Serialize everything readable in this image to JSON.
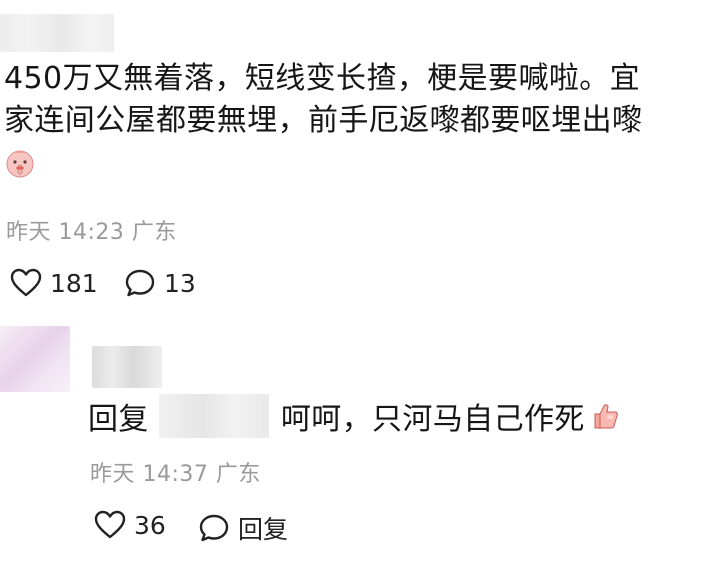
{
  "comment": {
    "text_line1": "450万又無着落，短线变长揸，梗是要喊啦。宜",
    "text_line2": "家连间公屋都要無埋，前手厄返嚟都要呕埋出嚟",
    "emoji": "shush-face-icon",
    "meta": "昨天 14:23 广东",
    "likes": "181",
    "comments": "13"
  },
  "reply": {
    "prefix": "回复",
    "text": "呵呵，只河马自己作死",
    "emoji": "thumbs-up-icon",
    "meta": "昨天 14:37 广东",
    "likes": "36",
    "reply_label": "回复"
  }
}
